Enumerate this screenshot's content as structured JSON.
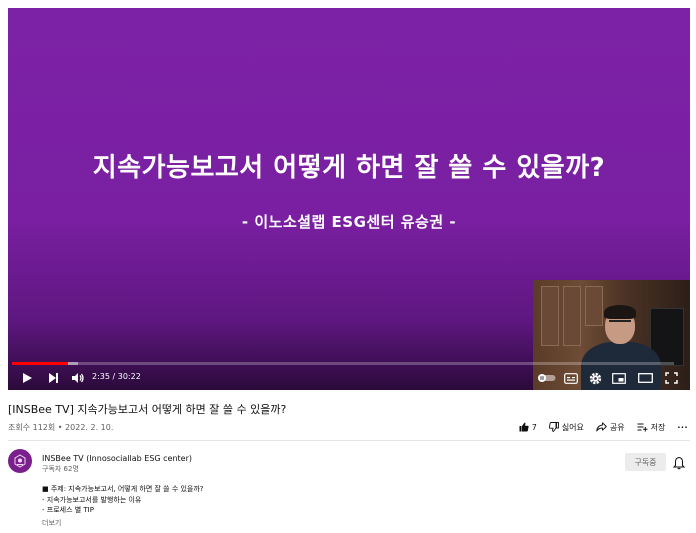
{
  "player": {
    "slide_title": "지속가능보고서 어떻게 하면 잘 쓸 수 있을까?",
    "slide_subtitle": "- 이노소셜랩 ESG센터 유승권 -",
    "background_color": "#7a1fa2",
    "progress_color": "#ff0000",
    "time_display": "2:35 / 30:22",
    "progress_fraction": 0.085,
    "buffer_fraction": 0.1,
    "controls": {
      "play_icon": "play-icon",
      "next_icon": "next-icon",
      "volume_icon": "volume-icon",
      "autoplay_icon": "autoplay-toggle-icon",
      "captions_icon": "captions-icon",
      "settings_icon": "settings-icon",
      "miniplayer_icon": "miniplayer-icon",
      "theater_icon": "theater-icon",
      "fullscreen_icon": "fullscreen-icon"
    }
  },
  "video": {
    "title": "[INSBee TV] 지속가능보고서 어떻게 하면 잘 쓸 수 있을까?",
    "meta": "조회수 112회 • 2022. 2. 10."
  },
  "actions": {
    "like_count": "7",
    "dislike_label": "싫어요",
    "share_label": "공유",
    "save_label": "저장",
    "more_label": "···"
  },
  "channel": {
    "name": "INSBee TV (Innosociallab ESG center)",
    "subscribers": "구독자 62명",
    "subscribe_label": "구독중"
  },
  "description": {
    "lines": [
      "■ 주제: 지속가능보고서, 어떻게 하면 잘 쓸 수 있을까?",
      " - 지속가능보고서를 발행하는 이유",
      " - 프로세스 별 TIP"
    ],
    "more_label": "더보기"
  }
}
